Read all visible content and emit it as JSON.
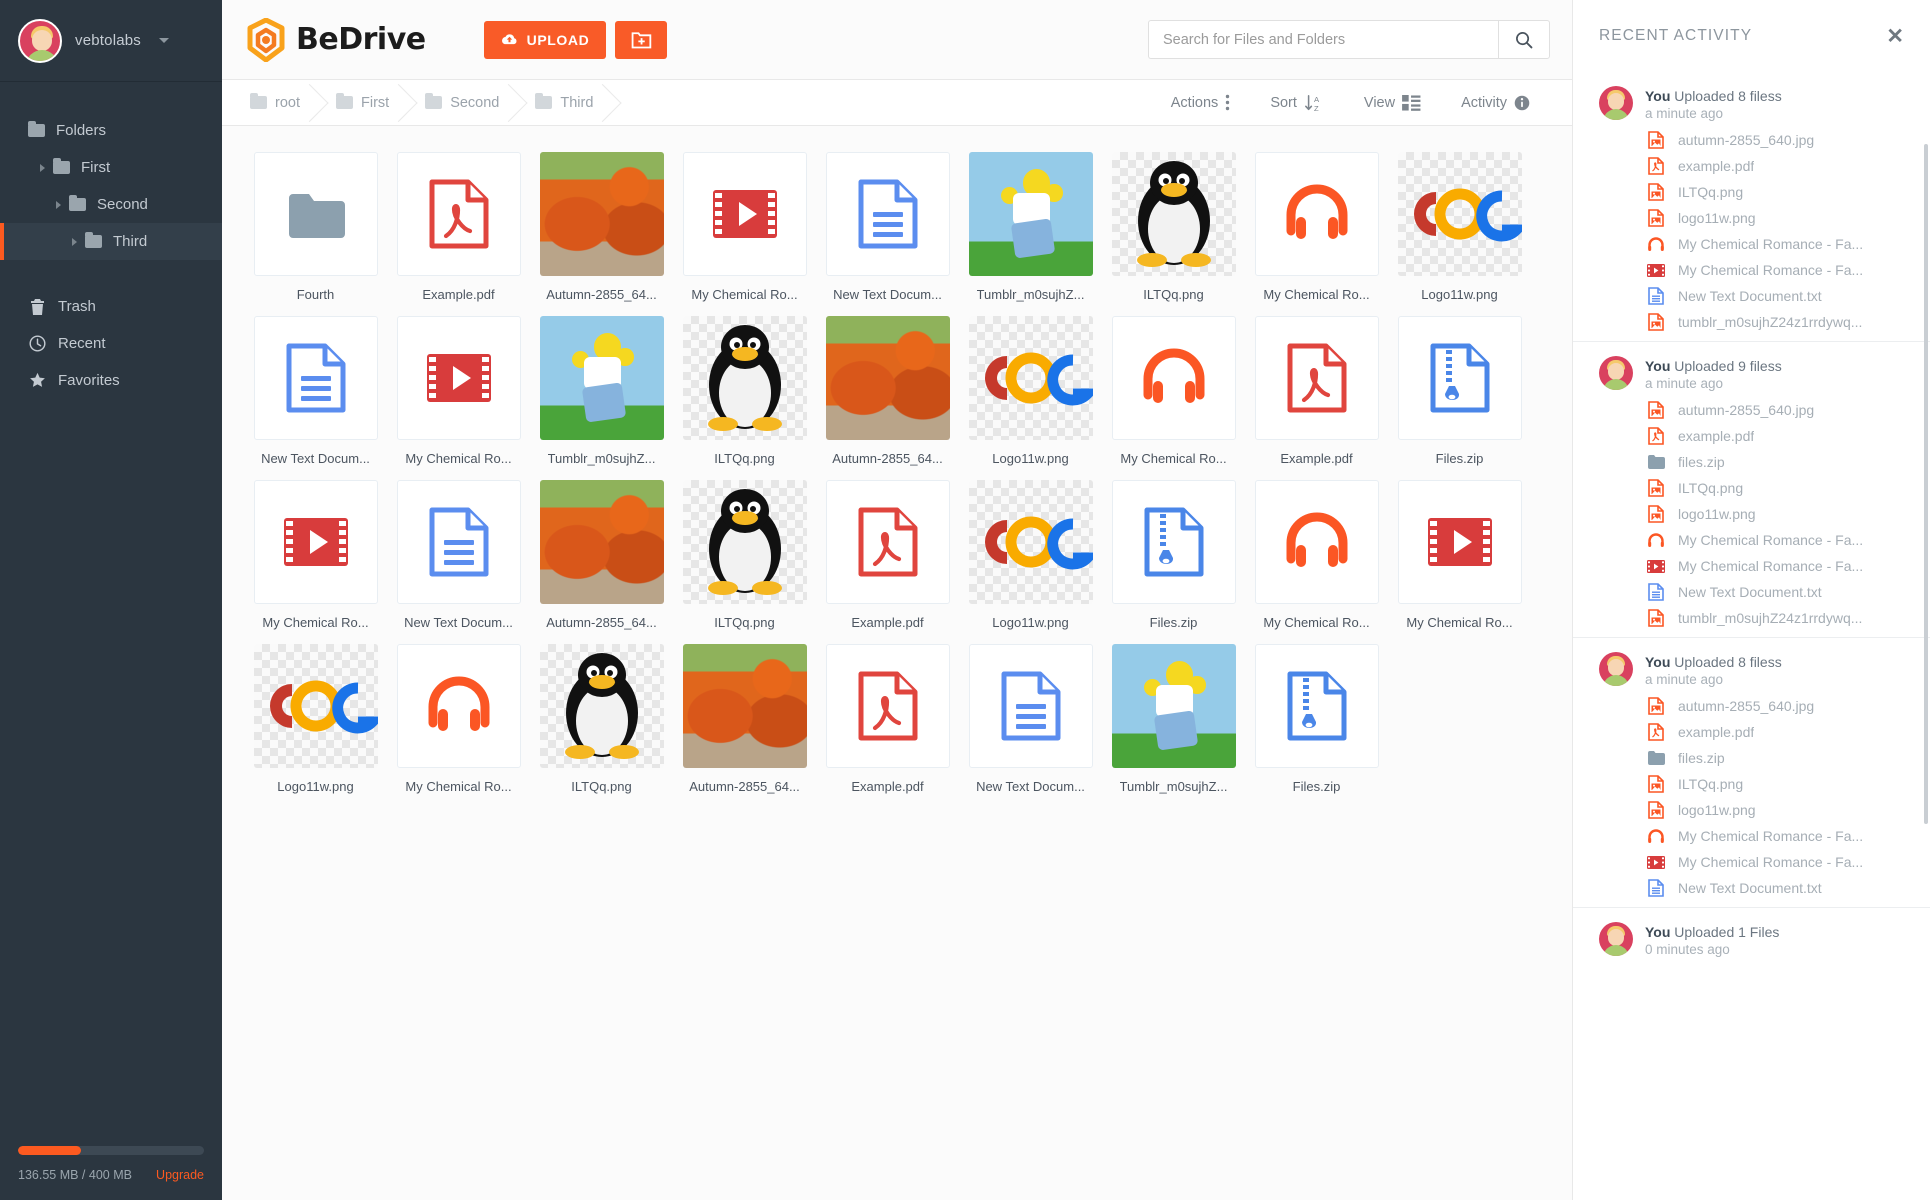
{
  "sidebar": {
    "user": {
      "name": "vebtolabs",
      "caret": "chevron-down-icon"
    },
    "items": [
      {
        "label": "Folders",
        "icon": "folder-icon",
        "indent": 0,
        "arrow": false,
        "active": false
      },
      {
        "label": "First",
        "icon": "folder-icon",
        "indent": 1,
        "arrow": true,
        "active": false
      },
      {
        "label": "Second",
        "icon": "folder-icon",
        "indent": 2,
        "arrow": true,
        "active": false
      },
      {
        "label": "Third",
        "icon": "folder-icon",
        "indent": 3,
        "arrow": true,
        "active": true
      }
    ],
    "shortcuts": [
      {
        "label": "Trash",
        "icon": "trash-icon"
      },
      {
        "label": "Recent",
        "icon": "clock-icon"
      },
      {
        "label": "Favorites",
        "icon": "star-icon"
      }
    ],
    "storage": {
      "used_percent": 34,
      "text": "136.55 MB / 400 MB",
      "upgrade_label": "Upgrade"
    }
  },
  "header": {
    "brand": "BeDrive",
    "logo_icon": "bedrive-hexagon-logo",
    "upload_label": "UPLOAD",
    "upload_icon": "cloud-upload-icon",
    "new_folder_icon": "new-folder-icon",
    "search": {
      "placeholder": "Search for Files and Folders",
      "value": "",
      "icon": "search-icon"
    }
  },
  "breadcrumb": [
    {
      "label": "root",
      "icon": "folder-icon"
    },
    {
      "label": "First",
      "icon": "folder-icon"
    },
    {
      "label": "Second",
      "icon": "folder-icon"
    },
    {
      "label": "Third",
      "icon": "folder-icon"
    }
  ],
  "toolbar": {
    "actions_label": "Actions",
    "actions_icon": "vertical-dots-icon",
    "sort_label": "Sort",
    "sort_icon": "sort-az-icon",
    "view_label": "View",
    "view_icon": "grid-view-icon",
    "activity_label": "Activity",
    "activity_icon": "info-icon"
  },
  "files": [
    {
      "label": "Fourth",
      "type": "folder"
    },
    {
      "label": "Example.pdf",
      "type": "pdf"
    },
    {
      "label": "Autumn-2855_64...",
      "type": "image-pumpkin"
    },
    {
      "label": "My Chemical Ro...",
      "type": "video"
    },
    {
      "label": "New Text Docum...",
      "type": "text"
    },
    {
      "label": "Tumblr_m0sujhZ...",
      "type": "image-homer"
    },
    {
      "label": "ILTQq.png",
      "type": "image-penguin"
    },
    {
      "label": "My Chemical Ro...",
      "type": "audio"
    },
    {
      "label": "Logo11w.png",
      "type": "image-google"
    },
    {
      "label": "New Text Docum...",
      "type": "text"
    },
    {
      "label": "My Chemical Ro...",
      "type": "video"
    },
    {
      "label": "Tumblr_m0sujhZ...",
      "type": "image-homer"
    },
    {
      "label": "ILTQq.png",
      "type": "image-penguin"
    },
    {
      "label": "Autumn-2855_64...",
      "type": "image-pumpkin"
    },
    {
      "label": "Logo11w.png",
      "type": "image-google"
    },
    {
      "label": "My Chemical Ro...",
      "type": "audio"
    },
    {
      "label": "Example.pdf",
      "type": "pdf"
    },
    {
      "label": "Files.zip",
      "type": "zip"
    },
    {
      "label": "My Chemical Ro...",
      "type": "video"
    },
    {
      "label": "New Text Docum...",
      "type": "text"
    },
    {
      "label": "Autumn-2855_64...",
      "type": "image-pumpkin"
    },
    {
      "label": "ILTQq.png",
      "type": "image-penguin"
    },
    {
      "label": "Example.pdf",
      "type": "pdf"
    },
    {
      "label": "Logo11w.png",
      "type": "image-google"
    },
    {
      "label": "Files.zip",
      "type": "zip"
    },
    {
      "label": "My Chemical Ro...",
      "type": "audio"
    },
    {
      "label": "My Chemical Ro...",
      "type": "video"
    },
    {
      "label": "Logo11w.png",
      "type": "image-google"
    },
    {
      "label": "My Chemical Ro...",
      "type": "audio"
    },
    {
      "label": "ILTQq.png",
      "type": "image-penguin"
    },
    {
      "label": "Autumn-2855_64...",
      "type": "image-pumpkin"
    },
    {
      "label": "Example.pdf",
      "type": "pdf"
    },
    {
      "label": "New Text Docum...",
      "type": "text"
    },
    {
      "label": "Tumblr_m0sujhZ...",
      "type": "image-homer"
    },
    {
      "label": "Files.zip",
      "type": "zip"
    }
  ],
  "activity_panel": {
    "title": "RECENT ACTIVITY",
    "close_icon": "close-icon",
    "groups": [
      {
        "actor": "You",
        "action": " Uploaded 8 filess",
        "time": "a minute ago",
        "files": [
          {
            "name": "autumn-2855_640.jpg",
            "type": "image"
          },
          {
            "name": "example.pdf",
            "type": "pdf"
          },
          {
            "name": "ILTQq.png",
            "type": "image"
          },
          {
            "name": "logo11w.png",
            "type": "image"
          },
          {
            "name": "My Chemical Romance - Fa...",
            "type": "audio"
          },
          {
            "name": "My Chemical Romance - Fa...",
            "type": "video"
          },
          {
            "name": "New Text Document.txt",
            "type": "text"
          },
          {
            "name": "tumblr_m0sujhZ24z1rrdywq...",
            "type": "image"
          }
        ]
      },
      {
        "actor": "You",
        "action": " Uploaded 9 filess",
        "time": "a minute ago",
        "files": [
          {
            "name": "autumn-2855_640.jpg",
            "type": "image"
          },
          {
            "name": "example.pdf",
            "type": "pdf"
          },
          {
            "name": "files.zip",
            "type": "folder"
          },
          {
            "name": "ILTQq.png",
            "type": "image"
          },
          {
            "name": "logo11w.png",
            "type": "image"
          },
          {
            "name": "My Chemical Romance - Fa...",
            "type": "audio"
          },
          {
            "name": "My Chemical Romance - Fa...",
            "type": "video"
          },
          {
            "name": "New Text Document.txt",
            "type": "text"
          },
          {
            "name": "tumblr_m0sujhZ24z1rrdywq...",
            "type": "image"
          }
        ]
      },
      {
        "actor": "You",
        "action": " Uploaded 8 filess",
        "time": "a minute ago",
        "files": [
          {
            "name": "autumn-2855_640.jpg",
            "type": "image"
          },
          {
            "name": "example.pdf",
            "type": "pdf"
          },
          {
            "name": "files.zip",
            "type": "folder"
          },
          {
            "name": "ILTQq.png",
            "type": "image"
          },
          {
            "name": "logo11w.png",
            "type": "image"
          },
          {
            "name": "My Chemical Romance - Fa...",
            "type": "audio"
          },
          {
            "name": "My Chemical Romance - Fa...",
            "type": "video"
          },
          {
            "name": "New Text Document.txt",
            "type": "text"
          }
        ]
      },
      {
        "actor": "You",
        "action": " Uploaded 1 Files",
        "time": "0 minutes ago",
        "files": []
      }
    ]
  },
  "colors": {
    "accent": "#f95b28",
    "sidebar_bg": "#2b3640",
    "pdf_red": "#e0453e",
    "video_red": "#d83c3c",
    "text_blue": "#5b8def",
    "audio_orange": "#fb5624"
  }
}
